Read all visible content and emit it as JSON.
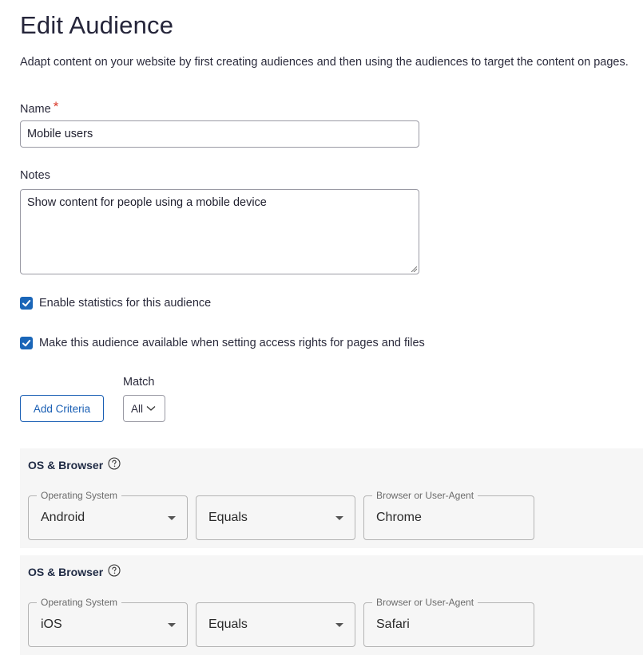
{
  "page": {
    "title": "Edit Audience",
    "intro": "Adapt content on your website by first creating audiences and then using the audiences to target the content on pages."
  },
  "form": {
    "name_label": "Name",
    "name_required_mark": "*",
    "name_value": "Mobile users",
    "notes_label": "Notes",
    "notes_value": "Show content for people using a mobile device",
    "enable_statistics": {
      "label": "Enable statistics for this audience",
      "checked": true
    },
    "access_rights": {
      "label": "Make this audience available when setting access rights for pages and files",
      "checked": true
    }
  },
  "criteria_controls": {
    "add_button": "Add Criteria",
    "match_label": "Match",
    "match_value": "All"
  },
  "criteria": [
    {
      "title": "OS & Browser",
      "os_label": "Operating System",
      "os_value": "Android",
      "operator_value": "Equals",
      "agent_label": "Browser or User-Agent",
      "agent_value": "Chrome"
    },
    {
      "title": "OS & Browser",
      "os_label": "Operating System",
      "os_value": "iOS",
      "operator_value": "Equals",
      "agent_label": "Browser or User-Agent",
      "agent_value": "Safari"
    }
  ],
  "colors": {
    "accent": "#1a66b8",
    "required": "#d93a2b",
    "panel_bg": "#f6f6f6"
  },
  "icons": {
    "checkbox": "check-icon",
    "match_dropdown": "chevron-down-icon",
    "help": "help-circle-icon",
    "select_arrow": "triangle-down-icon"
  }
}
